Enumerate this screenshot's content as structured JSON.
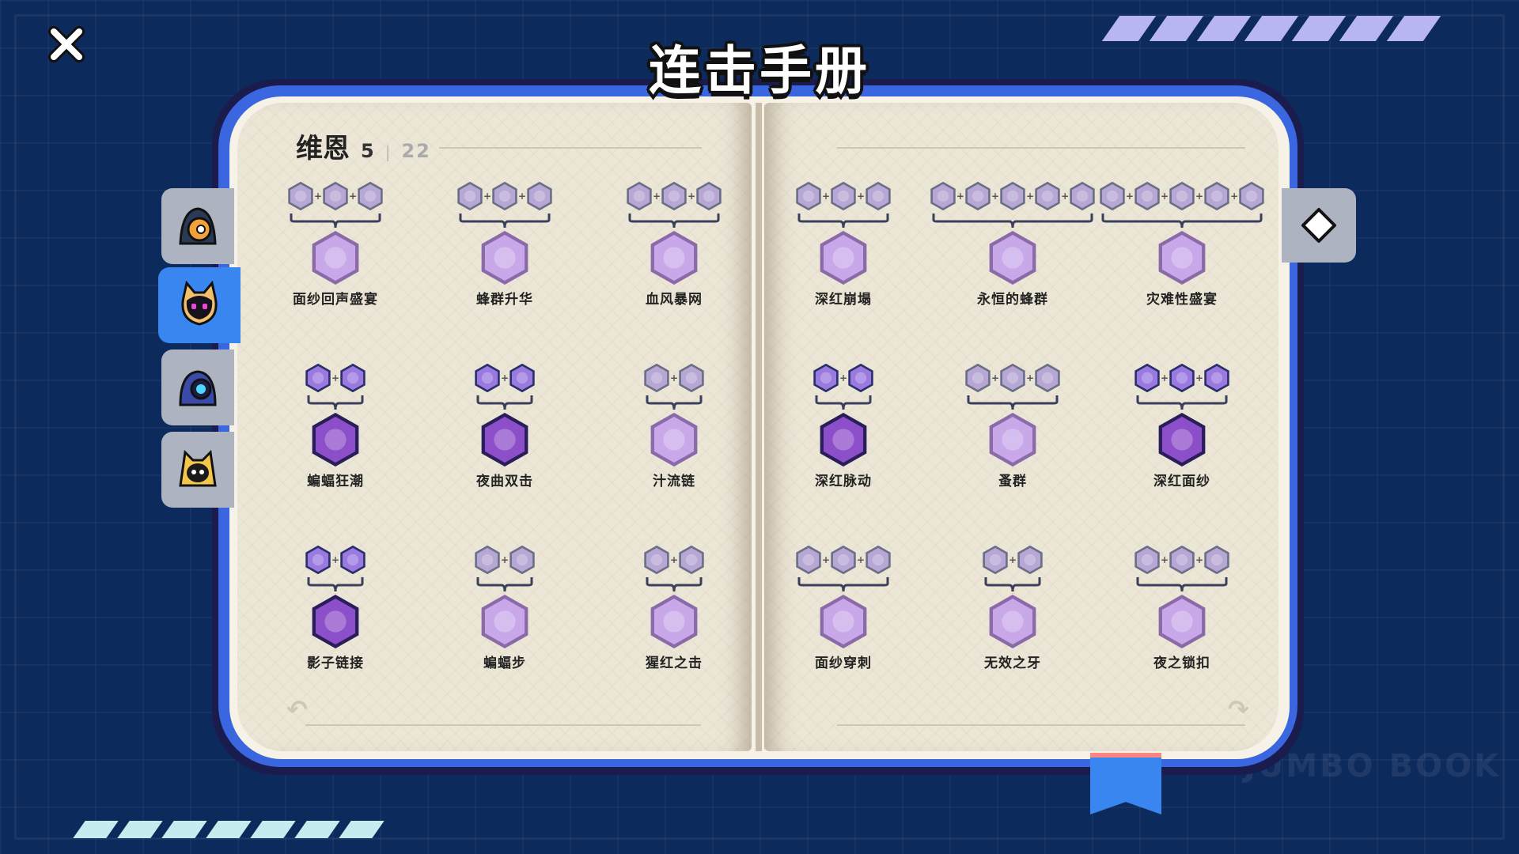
{
  "title": "连击手册",
  "watermark": "JUMBO BOOK",
  "colors": {
    "accent": "#3a86f0",
    "book_border": "#3a67e0",
    "page": "#ece6d7",
    "icon_purple": "#8c4fc9"
  },
  "header": {
    "character_name": "维恩",
    "unlocked": "5",
    "separator": "|",
    "total": "22"
  },
  "tabs": [
    {
      "icon": "hooded-orange-mask-character-icon",
      "active": false
    },
    {
      "icon": "black-cat-character-icon",
      "active": true
    },
    {
      "icon": "blue-robot-character-icon",
      "active": false
    },
    {
      "icon": "yellow-hooded-character-icon",
      "active": false
    }
  ],
  "right_tab": {
    "icon": "diamond-icon"
  },
  "combos": [
    {
      "name": "面纱回声盛宴",
      "ingredients": 3,
      "locked": true
    },
    {
      "name": "蜂群升华",
      "ingredients": 3,
      "locked": true
    },
    {
      "name": "血风暴网",
      "ingredients": 3,
      "locked": true
    },
    {
      "name": "深红崩塌",
      "ingredients": 3,
      "locked": true
    },
    {
      "name": "永恒的蜂群",
      "ingredients": 5,
      "locked": true
    },
    {
      "name": "灾难性盛宴",
      "ingredients": 5,
      "locked": true
    },
    {
      "name": "蝙蝠狂潮",
      "ingredients": 2,
      "locked": false
    },
    {
      "name": "夜曲双击",
      "ingredients": 2,
      "locked": false
    },
    {
      "name": "汁流链",
      "ingredients": 2,
      "locked": true
    },
    {
      "name": "深红脉动",
      "ingredients": 2,
      "locked": false
    },
    {
      "name": "蚤群",
      "ingredients": 3,
      "locked": true
    },
    {
      "name": "深红面纱",
      "ingredients": 3,
      "locked": false
    },
    {
      "name": "影子链接",
      "ingredients": 2,
      "locked": false
    },
    {
      "name": "蝙蝠步",
      "ingredients": 2,
      "locked": true
    },
    {
      "name": "猩红之击",
      "ingredients": 2,
      "locked": true
    },
    {
      "name": "面纱穿刺",
      "ingredients": 3,
      "locked": true
    },
    {
      "name": "无效之牙",
      "ingredients": 2,
      "locked": true
    },
    {
      "name": "夜之锁扣",
      "ingredients": 3,
      "locked": true
    }
  ]
}
